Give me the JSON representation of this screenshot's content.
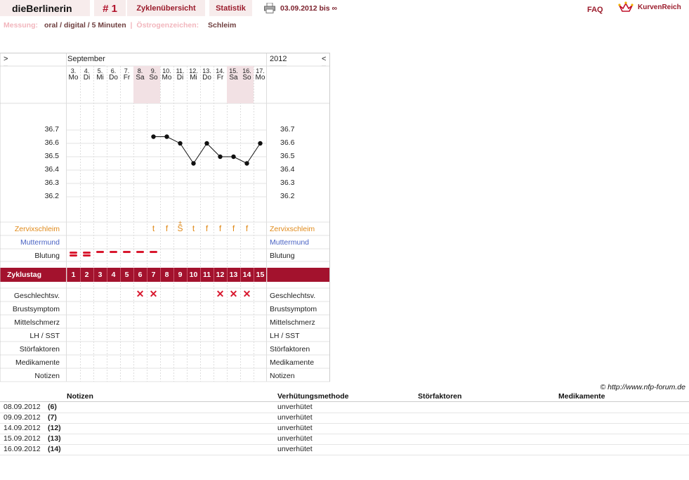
{
  "header": {
    "username": "dieBerlinerin",
    "cycle_number": "# 1",
    "nav_cycle_overview": "Zyklenübersicht",
    "nav_statistics": "Statistik",
    "date_range": "03.09.2012 bis ∞",
    "faq": "FAQ",
    "brand": "KurvenReich",
    "printer_icon": "printer-icon",
    "logo_icon": "crown-logo-icon"
  },
  "measurement": {
    "label": "Messung:",
    "value": "oral / digital / 5 Minuten",
    "separator": "|",
    "estrogen_label": "Östrogenzeichen:",
    "estrogen_value": "Schleim"
  },
  "chart_header": {
    "nav_prev": ">",
    "nav_next": "<",
    "month": "September",
    "year": "2012"
  },
  "chart_data": {
    "type": "line",
    "title": "",
    "xlabel": "",
    "ylabel": "",
    "days": [
      {
        "date": "3.",
        "wd": "Mo"
      },
      {
        "date": "4.",
        "wd": "Di"
      },
      {
        "date": "5.",
        "wd": "Mi"
      },
      {
        "date": "6.",
        "wd": "Do"
      },
      {
        "date": "7.",
        "wd": "Fr"
      },
      {
        "date": "8.",
        "wd": "Sa"
      },
      {
        "date": "9.",
        "wd": "So"
      },
      {
        "date": "10.",
        "wd": "Mo"
      },
      {
        "date": "11.",
        "wd": "Di"
      },
      {
        "date": "12.",
        "wd": "Mi"
      },
      {
        "date": "13.",
        "wd": "Do"
      },
      {
        "date": "14.",
        "wd": "Fr"
      },
      {
        "date": "15.",
        "wd": "Sa"
      },
      {
        "date": "16.",
        "wd": "So"
      },
      {
        "date": "17.",
        "wd": "Mo"
      }
    ],
    "weekend_days": [
      6,
      7,
      13,
      14
    ],
    "y_ticks": [
      "36.7",
      "36.6",
      "36.5",
      "36.4",
      "36.3",
      "36.2"
    ],
    "ylim": [
      36.2,
      36.7
    ],
    "series": [
      {
        "values": [
          null,
          null,
          null,
          null,
          null,
          null,
          36.65,
          36.65,
          36.6,
          36.45,
          36.6,
          36.5,
          36.5,
          36.45,
          36.6
        ]
      }
    ],
    "cycle_days": [
      "1",
      "2",
      "3",
      "4",
      "5",
      "6",
      "7",
      "8",
      "9",
      "10",
      "11",
      "12",
      "13",
      "14",
      "15"
    ],
    "cervical_mucus": [
      "",
      "",
      "",
      "",
      "",
      "",
      "t",
      "f",
      "S",
      "t",
      "f",
      "f",
      "f",
      "f",
      ""
    ],
    "mucus_plus_mark": "±",
    "bleeding": [
      "heavy",
      "heavy",
      "light",
      "light",
      "light",
      "light",
      "light",
      "",
      "",
      "",
      "",
      "",
      "",
      "",
      ""
    ],
    "intercourse": [
      "",
      "",
      "",
      "",
      "",
      "x",
      "x",
      "",
      "",
      "",
      "",
      "x",
      "x",
      "x",
      ""
    ],
    "colors": {
      "cycle_bar": "#a3122d",
      "mucus": "#e08a1a",
      "cervix": "#4a63c4",
      "bleeding": "#d8182e"
    }
  },
  "rows": {
    "cervical_mucus": "Zervixschleim",
    "cervix": "Muttermund",
    "bleeding": "Blutung",
    "cycle_day": "Zyklustag",
    "intercourse": "Geschlechtsv.",
    "breast": "Brustsymptom",
    "midpain": "Mittelschmerz",
    "lh": "LH / SST",
    "disturbance": "Störfaktoren",
    "medication": "Medikamente",
    "notes": "Notizen"
  },
  "copyright": "© http://www.nfp-forum.de",
  "notes_table": {
    "headers": [
      "Notizen",
      "Verhütungsmethode",
      "Störfaktoren",
      "Medikamente"
    ],
    "rows": [
      {
        "date": "08.09.2012",
        "day": "(6)",
        "method": "unverhütet"
      },
      {
        "date": "09.09.2012",
        "day": "(7)",
        "method": "unverhütet"
      },
      {
        "date": "14.09.2012",
        "day": "(12)",
        "method": "unverhütet"
      },
      {
        "date": "15.09.2012",
        "day": "(13)",
        "method": "unverhütet"
      },
      {
        "date": "16.09.2012",
        "day": "(14)",
        "method": "unverhütet"
      }
    ]
  }
}
